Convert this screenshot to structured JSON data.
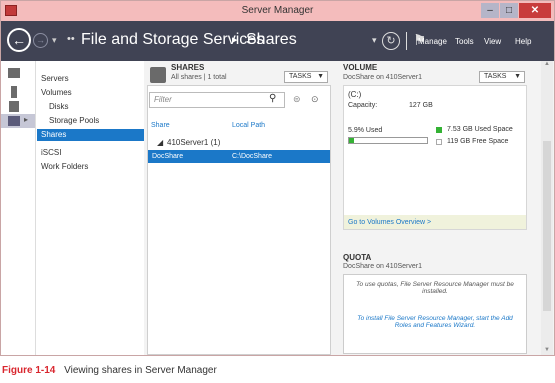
{
  "window": {
    "title": "Server Manager",
    "minimize_label": "–",
    "maximize_label": "□",
    "close_label": "✕"
  },
  "header": {
    "back_glyph": "←",
    "forward_glyph": "→",
    "dropdown_glyph": "▾",
    "breadcrumb_dots": "••",
    "breadcrumb_1": "File and Storage Services",
    "breadcrumb_sep": "▸",
    "breadcrumb_2": "Shares",
    "refresh_glyph": "↻",
    "flag_glyph": "⚑",
    "menus": [
      "Manage",
      "Tools",
      "View",
      "Help"
    ]
  },
  "nav": {
    "items": [
      {
        "label": "Servers",
        "selected": false
      },
      {
        "label": "Volumes",
        "selected": false
      },
      {
        "label": "Disks",
        "selected": false
      },
      {
        "label": "Storage Pools",
        "selected": false
      },
      {
        "label": "Shares",
        "selected": true
      },
      {
        "label": "iSCSI",
        "selected": false
      },
      {
        "label": "Work Folders",
        "selected": false
      }
    ]
  },
  "shares": {
    "title": "SHARES",
    "subtitle": "All shares | 1 total",
    "tasks_label": "TASKS",
    "filter_placeholder": "Filter",
    "columns": [
      "Share",
      "Local Path"
    ],
    "group": "410Server1 (1)",
    "rows": [
      {
        "share": "DocShare",
        "path": "C:\\DocShare"
      }
    ]
  },
  "volume": {
    "title": "VOLUME",
    "subtitle": "DocShare on 410Server1",
    "tasks_label": "TASKS",
    "drive": "(C:)",
    "capacity_label": "Capacity:",
    "capacity_value": "127 GB",
    "used_label": "5.9% Used",
    "used_fraction": 0.059,
    "used_legend": "7.53 GB Used Space",
    "free_legend": "119 GB Free Space",
    "overview_link": "Go to Volumes Overview >"
  },
  "quota": {
    "title": "QUOTA",
    "subtitle": "DocShare on 410Server1",
    "msg1": "To use quotas, File Server Resource Manager must be installed.",
    "msg2": "To install File Server Resource Manager, start the Add Roles and Features Wizard."
  },
  "caption": {
    "figure": "Figure 1-14",
    "text": "Viewing shares in Server Manager"
  },
  "colors": {
    "accent": "#1b78c8",
    "used": "#34b234",
    "header": "#404354",
    "titlebar": "#f4bcbc",
    "figure_label": "#d9262e"
  }
}
